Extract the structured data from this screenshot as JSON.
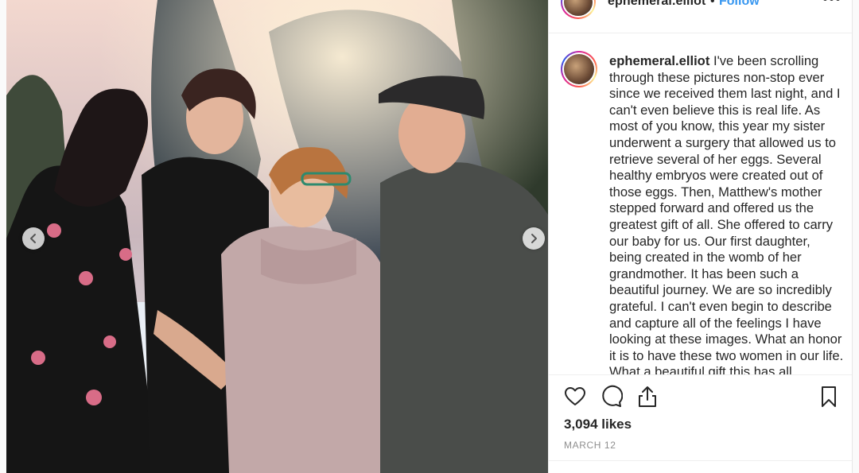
{
  "post": {
    "username": "ephemeral.elliot",
    "separator": "•",
    "follow_label": "Follow",
    "more_label": "•••",
    "caption": {
      "username": "ephemeral.elliot",
      "text": "I've been scrolling through these pictures non-stop ever since we received them last night, and I can't even believe this is real life. As most of you know, this year my sister underwent a surgery that allowed us to retrieve several of her eggs. Several healthy embryos were created out of those eggs. Then, Matthew's mother stepped forward and offered us the greatest gift of all. She offered to carry our baby for us. Our first daughter, being created in the womb of her grandmother. It has been such a beautiful journey. We are so incredibly grateful. I can't even begin to describe and capture all of the feelings I have looking at these images. What an honor it is to have these two women in our life. What a beautiful gift this has all"
    },
    "likes": "3,094 likes",
    "date": "MARCH 12"
  },
  "icons": {
    "prev": "chevron-left-icon",
    "next": "chevron-right-icon",
    "like": "heart-icon",
    "comment": "comment-icon",
    "share": "share-icon",
    "save": "bookmark-icon"
  },
  "colors": {
    "follow": "#3897f0",
    "text": "#262626",
    "muted": "#8e8e8e",
    "border": "#efefef"
  }
}
